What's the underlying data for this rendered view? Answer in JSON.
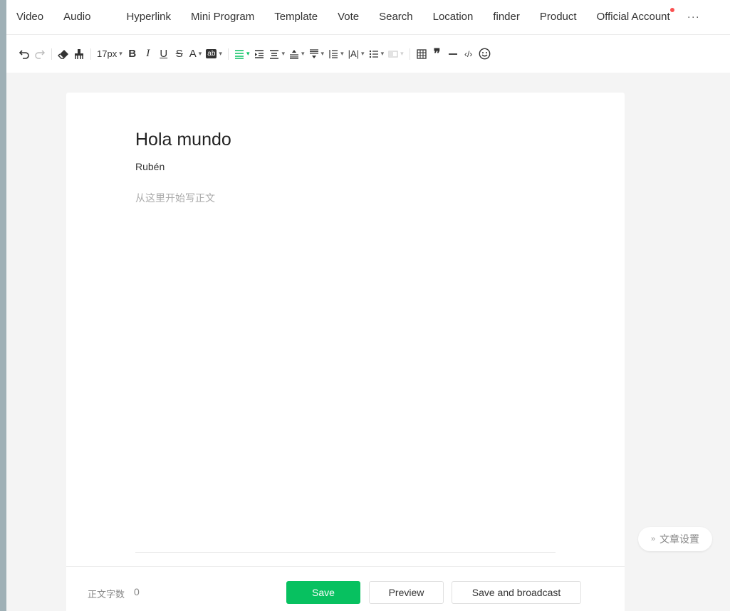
{
  "menu": {
    "tabs": [
      "Video",
      "Audio",
      "",
      "Hyperlink",
      "Mini Program",
      "Template",
      "Vote",
      "Search",
      "Location",
      "finder",
      "Product",
      "Official Account"
    ],
    "more": "···"
  },
  "toolbar": {
    "font_size": "17px",
    "bold": "B",
    "italic": "I",
    "underline": "U",
    "strike": "S",
    "font_color": "A",
    "bg_color": "ab",
    "letter_spacing": "|A|",
    "quote": "❞",
    "code": "‹/›"
  },
  "document": {
    "title": "Hola mundo",
    "author": "Rubén",
    "body_placeholder": "从这里开始写正文"
  },
  "footer": {
    "wordcount_label": "正文字数",
    "wordcount": "0",
    "save": "Save",
    "preview": "Preview",
    "save_broadcast": "Save and broadcast"
  },
  "settings_pill": "文章设置",
  "colors": {
    "accent": "#07c160",
    "notification_dot": "#fa5151"
  }
}
